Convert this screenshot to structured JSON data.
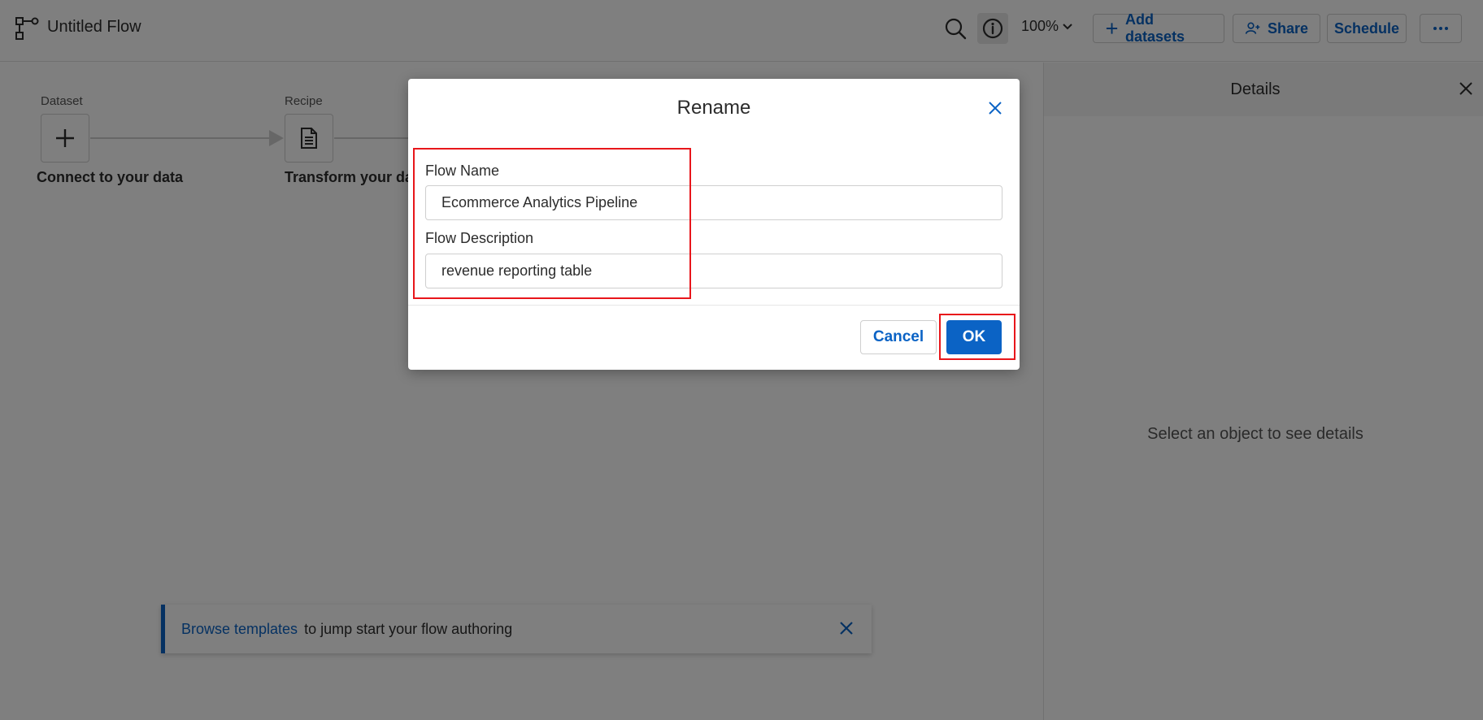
{
  "header": {
    "title": "Untitled Flow",
    "zoom": "100%",
    "add_datasets": "Add datasets",
    "share": "Share",
    "schedule": "Schedule"
  },
  "canvas": {
    "nodes": [
      {
        "type_label": "Dataset",
        "caption": "Connect to your data",
        "icon": "plus-icon"
      },
      {
        "type_label": "Recipe",
        "caption": "Transform your dat",
        "icon": "document-icon"
      }
    ],
    "banner": {
      "link": "Browse templates",
      "text": "to jump start your flow authoring"
    }
  },
  "details": {
    "title": "Details",
    "empty_text": "Select an object to see details"
  },
  "dialog": {
    "title": "Rename",
    "name_label": "Flow Name",
    "name_value": "Ecommerce Analytics Pipeline",
    "description_label": "Flow Description",
    "description_value": "revenue reporting table",
    "cancel": "Cancel",
    "ok": "OK"
  },
  "colors": {
    "accent": "#0b63c5",
    "highlight": "#e8161b",
    "overlay": "rgba(0,0,0,0.5)"
  }
}
